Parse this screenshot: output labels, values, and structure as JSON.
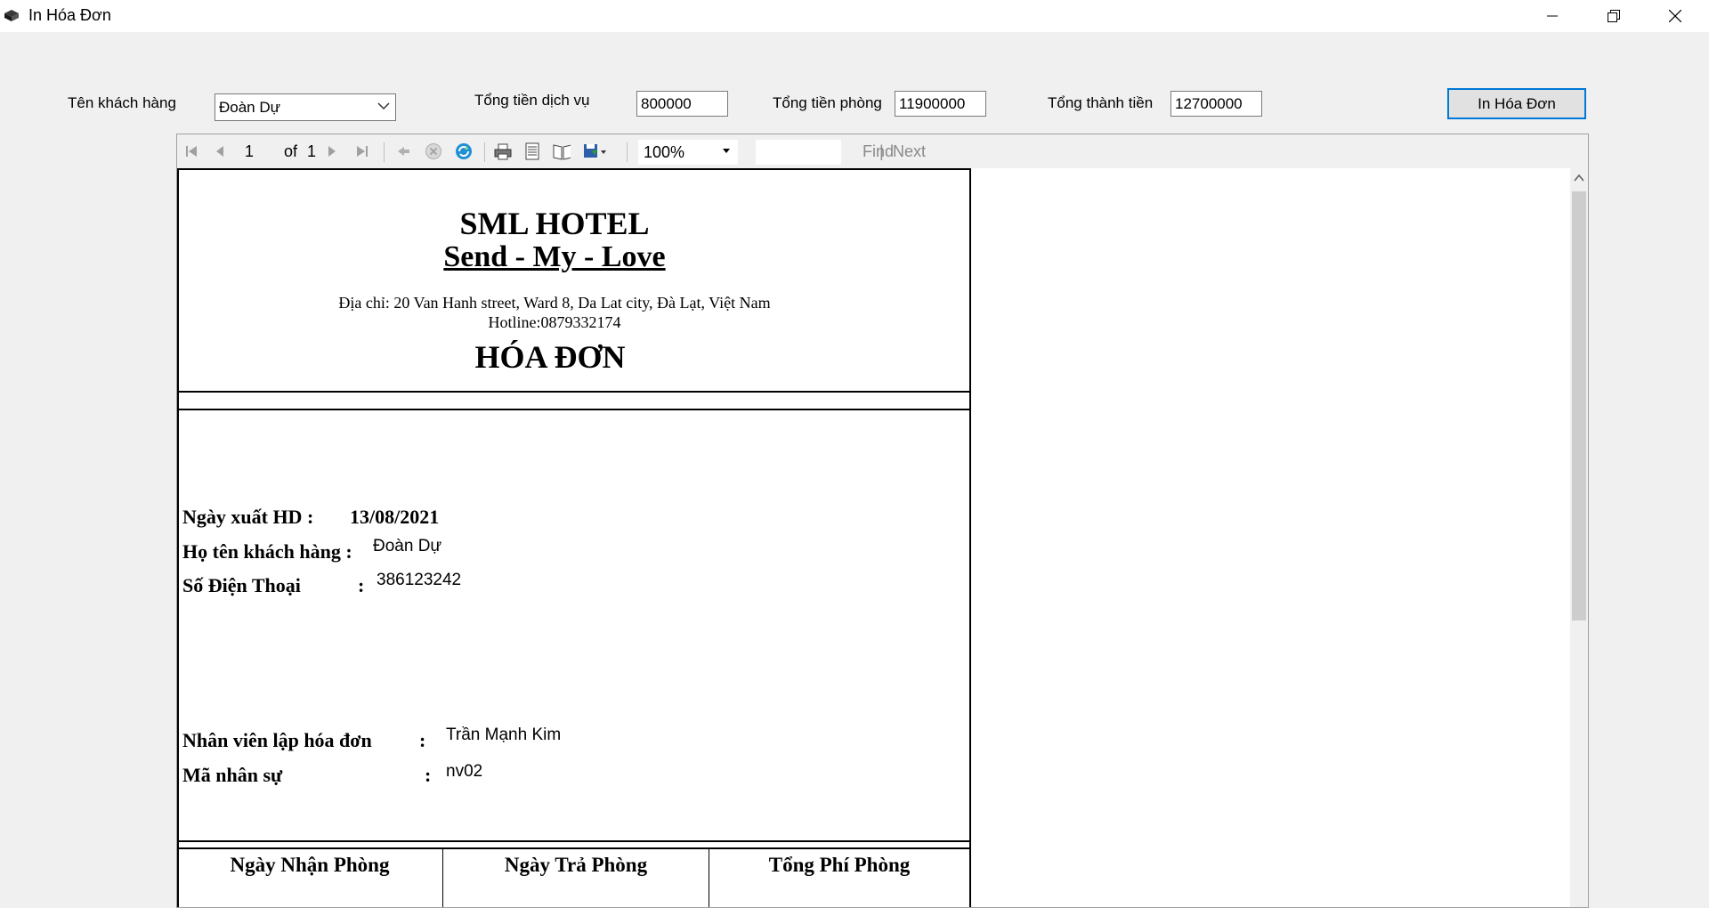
{
  "window": {
    "title": "In Hóa Đơn",
    "icon": "printer-app-icon"
  },
  "form": {
    "customer_label": "Tên khách hàng",
    "customer_value": "Đoàn Dự",
    "service_total_label": "Tổng tiền dịch vụ",
    "service_total_value": "800000",
    "room_total_label": "Tổng tiền phòng",
    "room_total_value": "11900000",
    "grand_total_label": "Tổng thành tiền",
    "grand_total_value": "12700000",
    "print_button": "In Hóa Đơn"
  },
  "viewer_toolbar": {
    "page_current": "1",
    "page_of": "of",
    "page_total": "1",
    "zoom": "100%",
    "find": "Find",
    "next": "Next",
    "separator": "|"
  },
  "report": {
    "hotel_name": "SML HOTEL",
    "slogan": "Send - My - Love",
    "address": "Địa chỉ: 20 Van Hanh street, Ward 8, Da Lat city, Đà Lạt, Việt Nam",
    "hotline": "Hotline:0879332174",
    "doc_title": "HÓA ĐƠN",
    "issue_date_label": "Ngày xuất HD :",
    "issue_date_value": "13/08/2021",
    "customer_name_label": "Họ tên khách hàng :",
    "customer_name_value": "Đoàn Dự",
    "phone_label": "Số Điện Thoại",
    "phone_colon": ":",
    "phone_value": "386123242",
    "staff_label": "Nhân viên lập hóa đơn",
    "staff_colon": ":",
    "staff_value": "Trần Mạnh Kim",
    "staff_id_label": "Mã nhân sự",
    "staff_id_colon": ":",
    "staff_id_value": "nv02",
    "table_headers": [
      "Ngày Nhận Phòng",
      "Ngày Trả Phòng",
      "Tổng Phí Phòng"
    ]
  }
}
